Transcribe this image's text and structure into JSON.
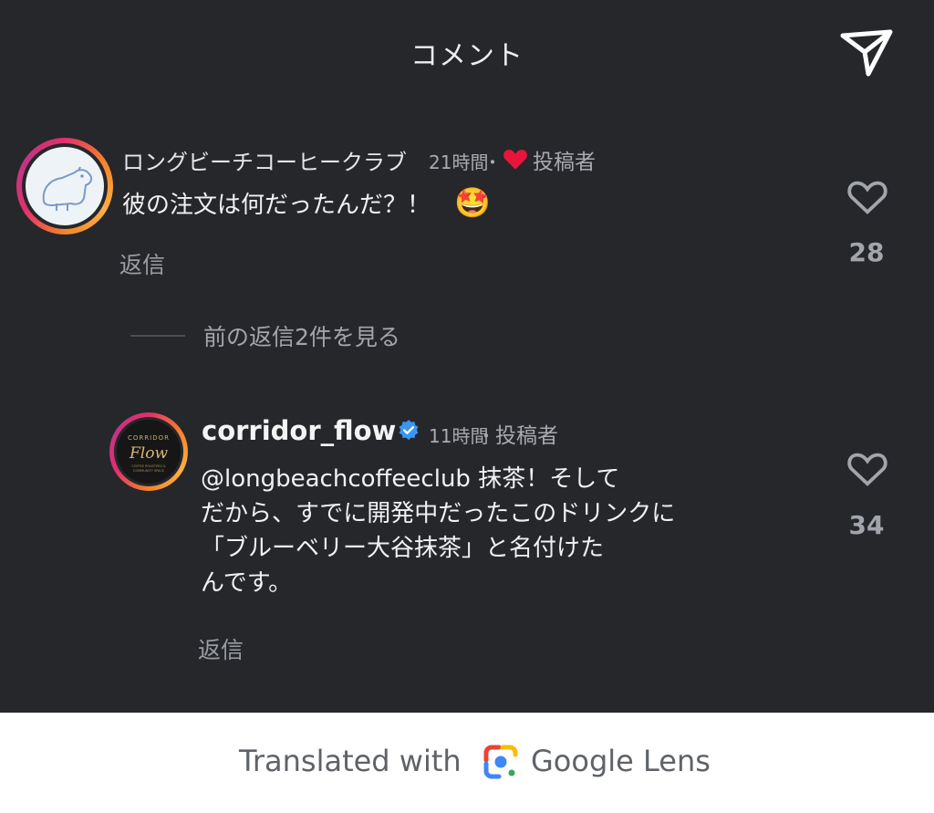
{
  "header": {
    "title": "コメント",
    "send_icon": "send-icon"
  },
  "comments": [
    {
      "username": "ロングビーチコーヒークラブ",
      "time": "21時間",
      "dot": "・",
      "creator_label": "投稿者",
      "text": "彼の注文は何だったんだ？！",
      "emoji": "🤩",
      "reply_label": "返信",
      "like_count": "28"
    },
    {
      "username": "corridor_flow",
      "verified": true,
      "time": "11時間",
      "dot": "・",
      "creator_label": "投稿者",
      "text_lines": [
        "@longbeachcoffeeclub 抹茶！そして",
        "だから、すでに開発中だったこのドリンクに",
        "「ブルーベリー大谷抹茶」と名付けた",
        "んです。"
      ],
      "reply_label": "返信",
      "like_count": "34"
    }
  ],
  "view_previous": "前の返信2件を見る",
  "footer": {
    "translated_with": "Translated with",
    "google_lens": "Google Lens"
  },
  "colors": {
    "background": "#25272b",
    "heart_red": "#e8143c",
    "verified_blue": "#3897f0"
  }
}
